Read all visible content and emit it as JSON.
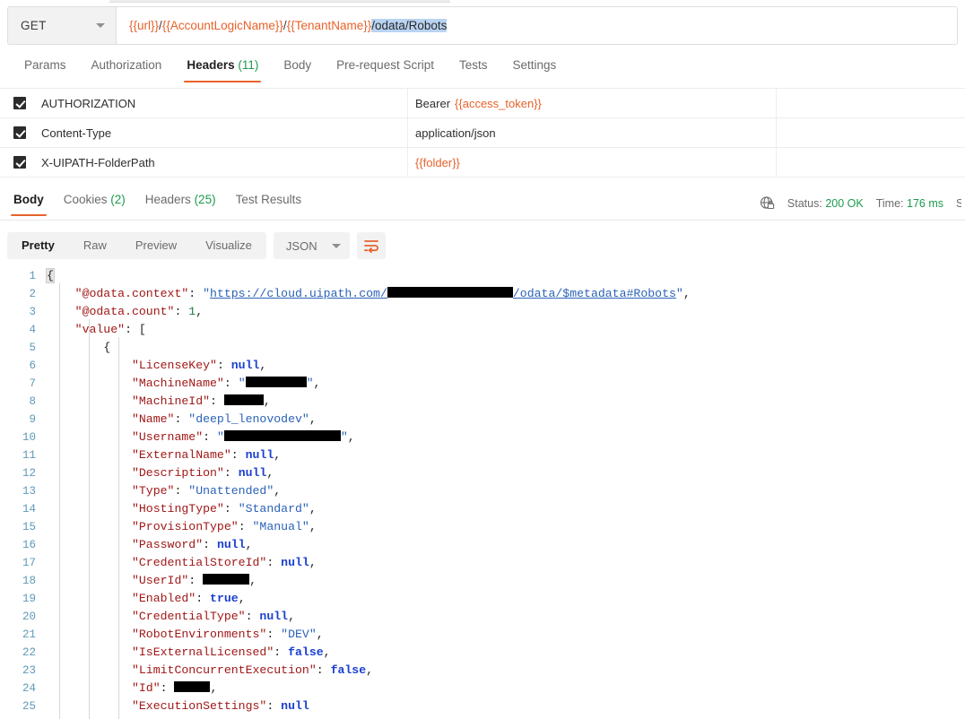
{
  "request": {
    "method": "GET",
    "url_parts": [
      {
        "text": "{{url}}",
        "type": "var"
      },
      {
        "text": "/",
        "type": "plain"
      },
      {
        "text": "{{AccountLogicName}}",
        "type": "var"
      },
      {
        "text": "/",
        "type": "plain"
      },
      {
        "text": "{{TenantName}}",
        "type": "var"
      },
      {
        "text": "/odata/Robots",
        "type": "selected"
      }
    ],
    "url_full": "{{url}}/{{AccountLogicName}}/{{TenantName}}/odata/Robots",
    "tabs": [
      {
        "label": "Params",
        "count": "",
        "active": false
      },
      {
        "label": "Authorization",
        "count": "",
        "active": false
      },
      {
        "label": "Headers",
        "count": "(11)",
        "active": true
      },
      {
        "label": "Body",
        "count": "",
        "active": false
      },
      {
        "label": "Pre-request Script",
        "count": "",
        "active": false
      },
      {
        "label": "Tests",
        "count": "",
        "active": false
      },
      {
        "label": "Settings",
        "count": "",
        "active": false
      }
    ],
    "headers": [
      {
        "enabled": true,
        "key": "AUTHORIZATION",
        "value_plain": "Bearer ",
        "value_var": "{{access_token}}",
        "description": ""
      },
      {
        "enabled": true,
        "key": "Content-Type",
        "value_plain": "application/json",
        "value_var": "",
        "description": ""
      },
      {
        "enabled": true,
        "key": "X-UIPATH-FolderPath",
        "value_plain": "",
        "value_var": "{{folder}}",
        "description": ""
      }
    ]
  },
  "response": {
    "tabs": [
      {
        "label": "Body",
        "count": "",
        "active": true
      },
      {
        "label": "Cookies",
        "count": "(2)",
        "active": false
      },
      {
        "label": "Headers",
        "count": "(25)",
        "active": false
      },
      {
        "label": "Test Results",
        "count": "",
        "active": false
      }
    ],
    "status_label": "Status:",
    "status_value": "200 OK",
    "time_label": "Time:",
    "time_value": "176 ms",
    "size_label_truncated": "S",
    "security_icon": "globe-lock-icon",
    "view_modes": [
      {
        "label": "Pretty",
        "active": true
      },
      {
        "label": "Raw",
        "active": false
      },
      {
        "label": "Preview",
        "active": false
      },
      {
        "label": "Visualize",
        "active": false
      }
    ],
    "format": "JSON",
    "wrap_icon": "word-wrap-icon"
  },
  "code": {
    "accent": "#e8622b",
    "lines": [
      {
        "n": 1,
        "indent": 0,
        "tokens": [
          {
            "t": "{",
            "c": "brkt"
          }
        ]
      },
      {
        "n": 2,
        "indent": 1,
        "tokens": [
          {
            "t": "\"@odata.context\"",
            "c": "k"
          },
          {
            "t": ": ",
            "c": "p"
          },
          {
            "t": "\"",
            "c": "s"
          },
          {
            "t": "https://cloud.uipath.com/",
            "c": "link"
          },
          {
            "t": "REDACT:140",
            "c": "redact"
          },
          {
            "t": "/odata/$metadata#Robots",
            "c": "link"
          },
          {
            "t": "\"",
            "c": "s"
          },
          {
            "t": ",",
            "c": "p"
          }
        ]
      },
      {
        "n": 3,
        "indent": 1,
        "tokens": [
          {
            "t": "\"@odata.count\"",
            "c": "k"
          },
          {
            "t": ": ",
            "c": "p"
          },
          {
            "t": "1",
            "c": "n"
          },
          {
            "t": ",",
            "c": "p"
          }
        ]
      },
      {
        "n": 4,
        "indent": 1,
        "tokens": [
          {
            "t": "\"value\"",
            "c": "k"
          },
          {
            "t": ": [",
            "c": "p"
          }
        ]
      },
      {
        "n": 5,
        "indent": 2,
        "tokens": [
          {
            "t": "{",
            "c": "p"
          }
        ]
      },
      {
        "n": 6,
        "indent": 3,
        "tokens": [
          {
            "t": "\"LicenseKey\"",
            "c": "k"
          },
          {
            "t": ": ",
            "c": "p"
          },
          {
            "t": "null",
            "c": "b"
          },
          {
            "t": ",",
            "c": "p"
          }
        ]
      },
      {
        "n": 7,
        "indent": 3,
        "tokens": [
          {
            "t": "\"MachineName\"",
            "c": "k"
          },
          {
            "t": ": ",
            "c": "p"
          },
          {
            "t": "\"",
            "c": "s"
          },
          {
            "t": "REDACT:68",
            "c": "redact"
          },
          {
            "t": "\"",
            "c": "s"
          },
          {
            "t": ",",
            "c": "p"
          }
        ]
      },
      {
        "n": 8,
        "indent": 3,
        "tokens": [
          {
            "t": "\"MachineId\"",
            "c": "k"
          },
          {
            "t": ": ",
            "c": "p"
          },
          {
            "t": "REDACT:44",
            "c": "redact"
          },
          {
            "t": ",",
            "c": "p"
          }
        ]
      },
      {
        "n": 9,
        "indent": 3,
        "tokens": [
          {
            "t": "\"Name\"",
            "c": "k"
          },
          {
            "t": ": ",
            "c": "p"
          },
          {
            "t": "\"deepl_lenovodev\"",
            "c": "s"
          },
          {
            "t": ",",
            "c": "p"
          }
        ]
      },
      {
        "n": 10,
        "indent": 3,
        "tokens": [
          {
            "t": "\"Username\"",
            "c": "k"
          },
          {
            "t": ": ",
            "c": "p"
          },
          {
            "t": "\"",
            "c": "s"
          },
          {
            "t": "REDACT:130",
            "c": "redact"
          },
          {
            "t": "\"",
            "c": "s"
          },
          {
            "t": ",",
            "c": "p"
          }
        ]
      },
      {
        "n": 11,
        "indent": 3,
        "tokens": [
          {
            "t": "\"ExternalName\"",
            "c": "k"
          },
          {
            "t": ": ",
            "c": "p"
          },
          {
            "t": "null",
            "c": "b"
          },
          {
            "t": ",",
            "c": "p"
          }
        ]
      },
      {
        "n": 12,
        "indent": 3,
        "tokens": [
          {
            "t": "\"Description\"",
            "c": "k"
          },
          {
            "t": ": ",
            "c": "p"
          },
          {
            "t": "null",
            "c": "b"
          },
          {
            "t": ",",
            "c": "p"
          }
        ]
      },
      {
        "n": 13,
        "indent": 3,
        "tokens": [
          {
            "t": "\"Type\"",
            "c": "k"
          },
          {
            "t": ": ",
            "c": "p"
          },
          {
            "t": "\"Unattended\"",
            "c": "s"
          },
          {
            "t": ",",
            "c": "p"
          }
        ]
      },
      {
        "n": 14,
        "indent": 3,
        "tokens": [
          {
            "t": "\"HostingType\"",
            "c": "k"
          },
          {
            "t": ": ",
            "c": "p"
          },
          {
            "t": "\"Standard\"",
            "c": "s"
          },
          {
            "t": ",",
            "c": "p"
          }
        ]
      },
      {
        "n": 15,
        "indent": 3,
        "tokens": [
          {
            "t": "\"ProvisionType\"",
            "c": "k"
          },
          {
            "t": ": ",
            "c": "p"
          },
          {
            "t": "\"Manual\"",
            "c": "s"
          },
          {
            "t": ",",
            "c": "p"
          }
        ]
      },
      {
        "n": 16,
        "indent": 3,
        "tokens": [
          {
            "t": "\"Password\"",
            "c": "k"
          },
          {
            "t": ": ",
            "c": "p"
          },
          {
            "t": "null",
            "c": "b"
          },
          {
            "t": ",",
            "c": "p"
          }
        ]
      },
      {
        "n": 17,
        "indent": 3,
        "tokens": [
          {
            "t": "\"CredentialStoreId\"",
            "c": "k"
          },
          {
            "t": ": ",
            "c": "p"
          },
          {
            "t": "null",
            "c": "b"
          },
          {
            "t": ",",
            "c": "p"
          }
        ]
      },
      {
        "n": 18,
        "indent": 3,
        "tokens": [
          {
            "t": "\"UserId\"",
            "c": "k"
          },
          {
            "t": ": ",
            "c": "p"
          },
          {
            "t": "REDACT:52",
            "c": "redact"
          },
          {
            "t": ",",
            "c": "p"
          }
        ]
      },
      {
        "n": 19,
        "indent": 3,
        "tokens": [
          {
            "t": "\"Enabled\"",
            "c": "k"
          },
          {
            "t": ": ",
            "c": "p"
          },
          {
            "t": "true",
            "c": "b"
          },
          {
            "t": ",",
            "c": "p"
          }
        ]
      },
      {
        "n": 20,
        "indent": 3,
        "tokens": [
          {
            "t": "\"CredentialType\"",
            "c": "k"
          },
          {
            "t": ": ",
            "c": "p"
          },
          {
            "t": "null",
            "c": "b"
          },
          {
            "t": ",",
            "c": "p"
          }
        ]
      },
      {
        "n": 21,
        "indent": 3,
        "tokens": [
          {
            "t": "\"RobotEnvironments\"",
            "c": "k"
          },
          {
            "t": ": ",
            "c": "p"
          },
          {
            "t": "\"DEV\"",
            "c": "s"
          },
          {
            "t": ",",
            "c": "p"
          }
        ]
      },
      {
        "n": 22,
        "indent": 3,
        "tokens": [
          {
            "t": "\"IsExternalLicensed\"",
            "c": "k"
          },
          {
            "t": ": ",
            "c": "p"
          },
          {
            "t": "false",
            "c": "b"
          },
          {
            "t": ",",
            "c": "p"
          }
        ]
      },
      {
        "n": 23,
        "indent": 3,
        "tokens": [
          {
            "t": "\"LimitConcurrentExecution\"",
            "c": "k"
          },
          {
            "t": ": ",
            "c": "p"
          },
          {
            "t": "false",
            "c": "b"
          },
          {
            "t": ",",
            "c": "p"
          }
        ]
      },
      {
        "n": 24,
        "indent": 3,
        "tokens": [
          {
            "t": "\"Id\"",
            "c": "k"
          },
          {
            "t": ": ",
            "c": "p"
          },
          {
            "t": "REDACT:40",
            "c": "redact"
          },
          {
            "t": ",",
            "c": "p"
          }
        ]
      },
      {
        "n": 25,
        "indent": 3,
        "tokens": [
          {
            "t": "\"ExecutionSettings\"",
            "c": "k"
          },
          {
            "t": ": ",
            "c": "p"
          },
          {
            "t": "null",
            "c": "b"
          }
        ]
      }
    ]
  }
}
